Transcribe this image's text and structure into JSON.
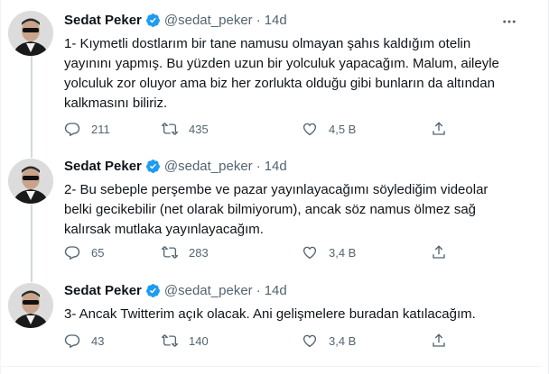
{
  "tweets": [
    {
      "name": "Sedat Peker",
      "handle": "@sedat_peker",
      "separator": "·",
      "time": "14d",
      "lines": [
        "1- Kıymetli dostlarım bir tane namusu olmayan şahıs kaldığım otelin",
        "yayınını yapmış. Bu yüzden uzun bir yolculuk yapacağım. Malum, aileyle",
        "yolculuk zor oluyor ama biz her zorlukta olduğu gibi bunların da altından",
        "kalkmasını biliriz."
      ],
      "replies": "211",
      "retweets": "435",
      "likes": "4,5 B"
    },
    {
      "name": "Sedat Peker",
      "handle": "@sedat_peker",
      "separator": "·",
      "time": "14d",
      "lines": [
        "2- Bu sebeple perşembe ve pazar yayınlayacağımı söylediğim videolar",
        "belki gecikebilir (net olarak bilmiyorum), ancak söz namus ölmez sağ",
        "kalırsak mutlaka yayınlayacağım."
      ],
      "replies": "65",
      "retweets": "283",
      "likes": "3,4 B"
    },
    {
      "name": "Sedat Peker",
      "handle": "@sedat_peker",
      "separator": "·",
      "time": "14d",
      "lines": [
        "3- Ancak Twitterim açık olacak. Ani gelişmelere buradan katılacağım."
      ],
      "replies": "43",
      "retweets": "140",
      "likes": "3,4 B"
    }
  ],
  "icons": {
    "reply": "reply-icon",
    "retweet": "retweet-icon",
    "like": "heart-icon",
    "share": "share-icon",
    "more": "more-icon",
    "verified": "verified-badge-icon"
  },
  "colors": {
    "verified": "#1d9bf0",
    "secondary_text": "#536471",
    "thread_line": "#cfd9de"
  }
}
